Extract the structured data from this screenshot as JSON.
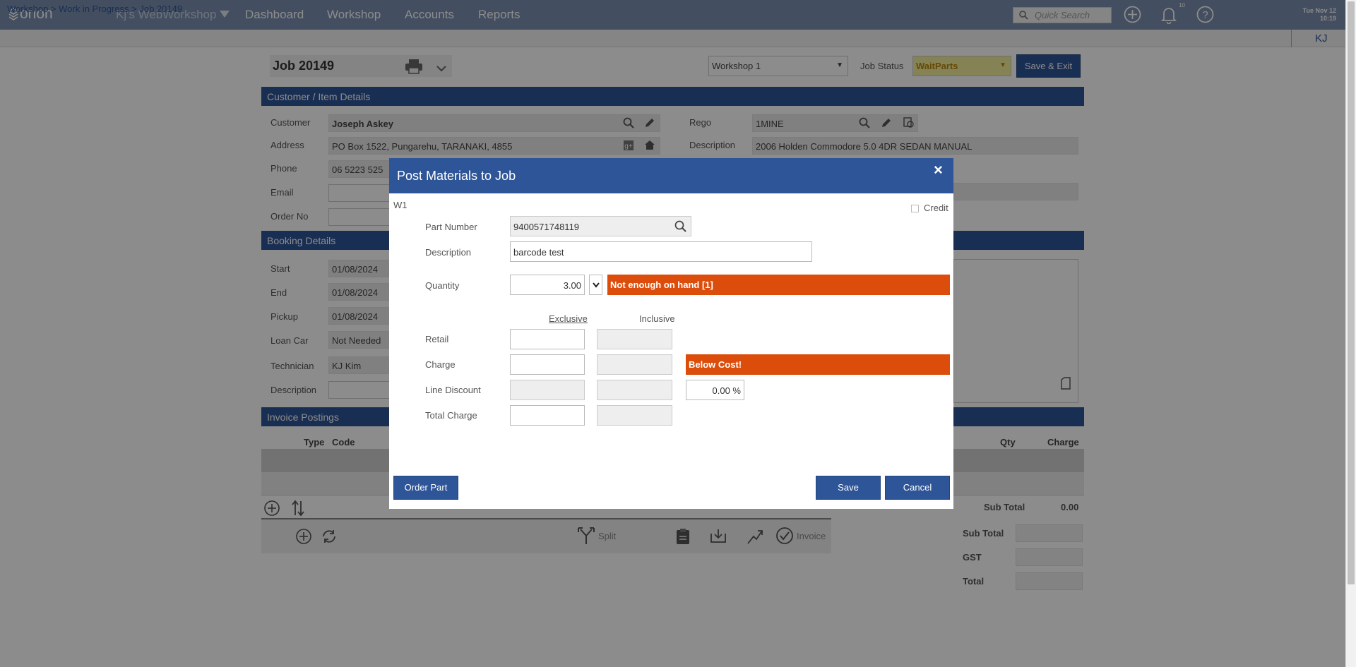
{
  "topbar": {
    "logo": "orion",
    "workshop_name": "Kj's WebWorkshop",
    "nav": [
      "Dashboard",
      "Workshop",
      "Accounts",
      "Reports"
    ],
    "quick_search_placeholder": "Quick Search",
    "notification_count": "10",
    "date": "Tue Nov 12",
    "time": "10:19",
    "user_initials": "KJ"
  },
  "breadcrumb": "Workshop > Work in Progress > Job 20149",
  "job": {
    "title": "Job 20149",
    "workshop_select": "Workshop 1",
    "status_label": "Job Status",
    "status_value": "WaitParts",
    "save_exit": "Save & Exit"
  },
  "customer_section": {
    "title": "Customer / Item Details",
    "customer_label": "Customer",
    "customer_value": "Joseph Askey",
    "address_label": "Address",
    "address_value": "PO Box 1522, Pungarehu, TARANAKI, 4855",
    "phone_label": "Phone",
    "phone_value": "06 5223 525",
    "email_label": "Email",
    "order_label": "Order No",
    "rego_label": "Rego",
    "rego_value": "1MINE",
    "desc_label": "Description",
    "desc_value": "2006 Holden Commodore 5.0 4DR SEDAN MANUAL"
  },
  "booking_section": {
    "title": "Booking Details",
    "start_label": "Start",
    "start_value": "01/08/2024",
    "end_label": "End",
    "end_value": "01/08/2024",
    "pickup_label": "Pickup",
    "pickup_value": "01/08/2024",
    "loan_label": "Loan Car",
    "loan_value": "Not Needed",
    "tech_label": "Technician",
    "tech_value": "KJ Kim",
    "desc_label": "Description"
  },
  "invoice_section": {
    "title": "Invoice Postings",
    "col_type": "Type",
    "col_code": "Code",
    "col_qty": "Qty",
    "col_charge": "Charge",
    "subtotal_label": "Sub Total",
    "subtotal_value": "0.00",
    "split_label": "Split",
    "invoice_label": "Invoice"
  },
  "totals": {
    "sub_total": "Sub Total",
    "gst": "GST",
    "total": "Total"
  },
  "modal": {
    "title": "Post Materials to Job",
    "close": "×",
    "workshop_code": "W1",
    "credit_label": "Credit",
    "part_number_label": "Part Number",
    "part_number_value": "9400571748119",
    "description_label": "Description",
    "description_value": "barcode test",
    "quantity_label": "Quantity",
    "quantity_value": "3.00",
    "qty_warning": "Not enough on hand [1]",
    "exclusive_header": "Exclusive",
    "inclusive_header": "Inclusive",
    "retail_label": "Retail",
    "charge_label": "Charge",
    "charge_warning": "Below Cost!",
    "line_discount_label": "Line Discount",
    "discount_percent": "0.00 %",
    "total_charge_label": "Total Charge",
    "order_part_button": "Order Part",
    "save_button": "Save",
    "cancel_button": "Cancel"
  },
  "colors": {
    "primary": "#2e5597",
    "topbar": "#7a8fb0",
    "warning": "#dc4c0a",
    "status_yellow": "#f3ef9d"
  }
}
